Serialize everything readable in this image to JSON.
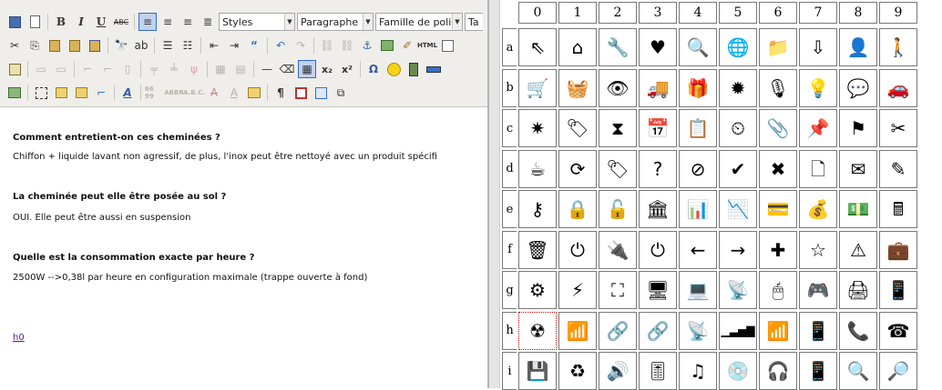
{
  "editor": {
    "toolbar": {
      "styles_value": "Styles",
      "format_value": "Paragraphe",
      "font_value": "Famille de polic",
      "size_value": "Ta",
      "bold": "B",
      "italic": "I",
      "underline": "U",
      "strike": "ABC",
      "html": "HTML",
      "subscript": "x₂",
      "superscript": "x²",
      "omega": "Ω",
      "pilcrow": "¶",
      "abbr1": "66 99",
      "abbr2": "ABBR",
      "abbr3": "A.B.C."
    },
    "content": {
      "q1": "Comment entretient-on ces cheminées ?",
      "a1": "Chiffon + liquide lavant non agressif, de plus, l'inox peut être nettoyé avec un produit spécifi",
      "q2": "La cheminée  peut elle être posée au sol ?",
      "a2": "OUI. Elle peut être aussi en suspension",
      "q3": "Quelle est la consommation exacte par heure ?",
      "a3": "2500W -->0,38l par heure en configuration maximale (trappe ouverte à fond)",
      "link": "h0"
    }
  },
  "grid": {
    "columns": [
      "0",
      "1",
      "2",
      "3",
      "4",
      "5",
      "6",
      "7",
      "8",
      "9"
    ],
    "rows": [
      {
        "label": "a",
        "cells": [
          "⇖",
          "⌂",
          "🔧",
          "♥",
          "🔍",
          "🌐",
          "📁",
          "⇩",
          "👤",
          "🚶"
        ],
        "names": [
          "cursor-icon",
          "home-icon",
          "wrench-icon",
          "heart-add-icon",
          "magnifier-icon",
          "globe-icon",
          "folder-icon",
          "download-icon",
          "user-icon",
          "person-icon"
        ]
      },
      {
        "label": "b",
        "cells": [
          "🛒",
          "🧺",
          "👁",
          "🚚",
          "🎁",
          "✹",
          "🎙",
          "💡",
          "💬",
          "🚗"
        ],
        "names": [
          "cart-icon",
          "basket-icon",
          "eye-icon",
          "truck-icon",
          "gift-icon",
          "badge-icon",
          "podcast-icon",
          "lightbulb-icon",
          "speech-bubble-icon",
          "car-icon"
        ]
      },
      {
        "label": "c",
        "cells": [
          "✷",
          "🏷",
          "⧗",
          "📅",
          "📋",
          "⏲",
          "📎",
          "📌",
          "⚑",
          "✂"
        ],
        "names": [
          "burst-icon",
          "tag-icon",
          "hourglass-icon",
          "calendar-icon",
          "clipboard-icon",
          "clock-icon",
          "paperclip-icon",
          "pushpin-icon",
          "flag-icon",
          "scissors-icon"
        ]
      },
      {
        "label": "d",
        "cells": [
          "☕",
          "⟳",
          "🏷",
          "?",
          "⊘",
          "✔",
          "✖",
          "🗋",
          "✉",
          "✎"
        ],
        "names": [
          "coffee-icon",
          "refresh-icon",
          "tag-add-icon",
          "help-icon",
          "forbidden-icon",
          "check-icon",
          "cross-icon",
          "document-icon",
          "envelope-icon",
          "pencil-icon"
        ]
      },
      {
        "label": "e",
        "cells": [
          "⚷",
          "🔒",
          "🔓",
          "🏛",
          "📊",
          "📉",
          "💳",
          "💰",
          "💵",
          "🖩"
        ],
        "names": [
          "key-icon",
          "lock-icon",
          "unlock-icon",
          "bank-icon",
          "chart-up-icon",
          "chart-down-icon",
          "credit-card-icon",
          "money-bag-icon",
          "banknote-icon",
          "calculator-icon"
        ]
      },
      {
        "label": "f",
        "cells": [
          "🗑",
          "⏻",
          "🔌",
          "⏻",
          "←",
          "→",
          "✚",
          "☆",
          "⚠",
          "💼"
        ],
        "names": [
          "trash-icon",
          "plug-icon",
          "unplug-icon",
          "power-icon",
          "arrow-left-icon",
          "arrow-right-icon",
          "plus-icon",
          "star-icon",
          "warning-icon",
          "briefcase-icon"
        ]
      },
      {
        "label": "g",
        "cells": [
          "⚙",
          "⚡",
          "⛶",
          "🖥",
          "💻",
          "📡",
          "🖱",
          "🎮",
          "🖨",
          "📱"
        ],
        "names": [
          "gears-icon",
          "lightning-icon",
          "sitemap-icon",
          "desktop-icon",
          "laptop-icon",
          "router-icon",
          "mouse-icon",
          "gamepad-icon",
          "printer-icon",
          "tablet-icon"
        ]
      },
      {
        "label": "h",
        "cells": [
          "☢",
          "📶",
          "🔗",
          "🔗",
          "📡",
          "▁▃▅▇",
          "📶",
          "📱",
          "📞",
          "☎"
        ],
        "names": [
          "radiation-icon",
          "rss-icon",
          "link-icon",
          "link-break-icon",
          "antenna-icon",
          "signal-bars-icon",
          "wifi-icon",
          "mobile-phone-icon",
          "phone-icon",
          "telephone-icon"
        ]
      },
      {
        "label": "i",
        "cells": [
          "💾",
          "♻",
          "🔊",
          "🎚",
          "♫",
          "💿",
          "🎧",
          "📱",
          "🔍",
          "🔎"
        ],
        "names": [
          "floppy-icon",
          "recycle-icon",
          "volume-icon",
          "equalizer-icon",
          "music-icon",
          "disc-icon",
          "headphones-icon",
          "mp3-player-icon",
          "zoom-out-icon",
          "zoom-in-icon"
        ]
      }
    ],
    "selected": {
      "row": "h",
      "col": "0"
    }
  }
}
